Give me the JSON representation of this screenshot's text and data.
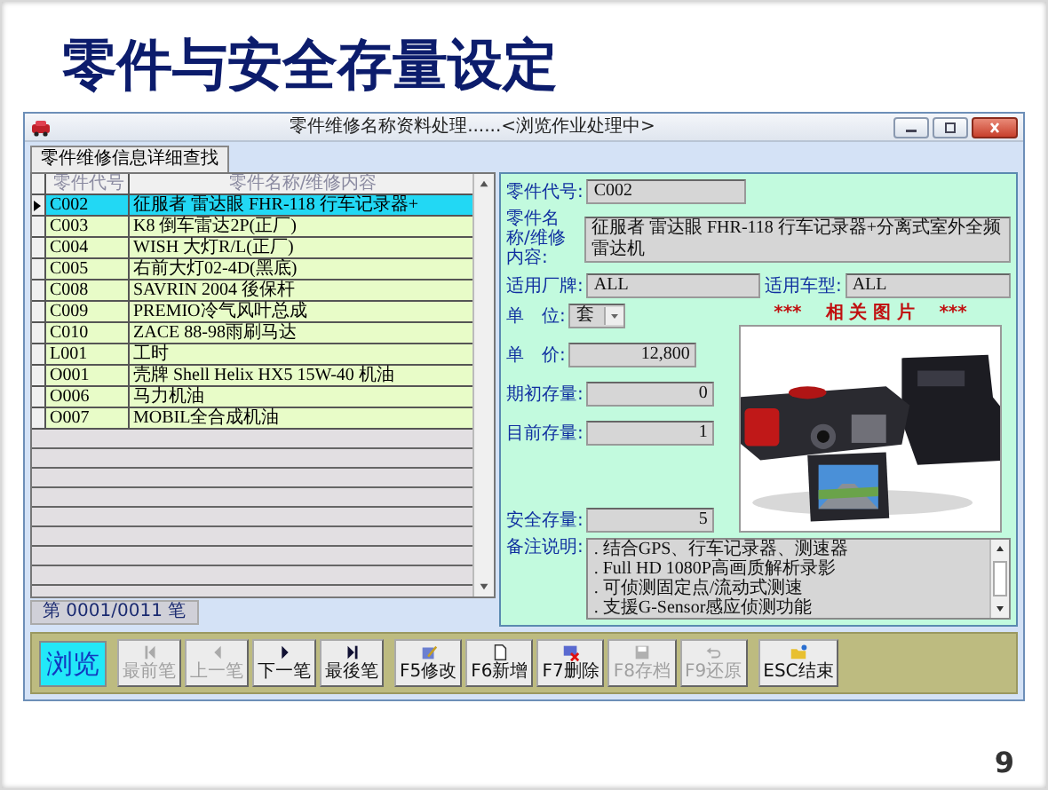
{
  "slide_title": "零件与安全存量设定",
  "window": {
    "title": "零件维修名称资料处理......<浏览作业处理中>"
  },
  "search_button": "零件维修信息详细查找",
  "table": {
    "columns": [
      "零件代号",
      "零件名称/维修内容"
    ],
    "rows": [
      {
        "code": "C002",
        "name": "征服者 雷达眼 FHR-118 行车记录器+",
        "selected": true
      },
      {
        "code": "C003",
        "name": "K8 倒车雷达2P(正厂)",
        "selected": false
      },
      {
        "code": "C004",
        "name": "WISH 大灯R/L(正厂)",
        "selected": false
      },
      {
        "code": "C005",
        "name": "右前大灯02-4D(黑底)",
        "selected": false
      },
      {
        "code": "C008",
        "name": "SAVRIN 2004 後保杆",
        "selected": false
      },
      {
        "code": "C009",
        "name": "PREMIO冷气风叶总成",
        "selected": false
      },
      {
        "code": "C010",
        "name": "ZACE 88-98雨刷马达",
        "selected": false
      },
      {
        "code": "L001",
        "name": "工时",
        "selected": false
      },
      {
        "code": "O001",
        "name": "壳牌 Shell Helix HX5 15W-40 机油",
        "selected": false
      },
      {
        "code": "O006",
        "name": "马力机油",
        "selected": false
      },
      {
        "code": "O007",
        "name": "MOBIL全合成机油",
        "selected": false
      }
    ]
  },
  "record_status": "第 0001/0011 笔",
  "form": {
    "code": {
      "label": "零件代号:",
      "value": "C002"
    },
    "name": {
      "label": "零件名称/维修内容:",
      "value": "征服者 雷达眼 FHR-118 行车记录器+分离式室外全频雷达机"
    },
    "brand": {
      "label": "适用厂牌:",
      "value": "ALL"
    },
    "model": {
      "label": "适用车型:",
      "value": "ALL"
    },
    "unit": {
      "label": "单　位:",
      "value": "套"
    },
    "price": {
      "label": "单　价:",
      "value": "12,800"
    },
    "opening_stock": {
      "label": "期初存量:",
      "value": "0"
    },
    "current_stock": {
      "label": "目前存量:",
      "value": "1"
    },
    "safety_stock": {
      "label": "安全存量:",
      "value": "5"
    },
    "picture_heading": "***　 相 关 图 片　 ***",
    "notes": {
      "label": "备注说明:",
      "lines": [
        ". 结合GPS、行车记录器、测速器",
        ". Full HD 1080P高画质解析录影",
        ". 可侦测固定点/流动式测速",
        ". 支援G-Sensor感应侦测功能"
      ]
    }
  },
  "button_bar": {
    "mode": "浏览",
    "groups": [
      [
        {
          "kind": "first",
          "label": "最前笔",
          "disabled": true
        },
        {
          "kind": "prev",
          "label": "上一笔",
          "disabled": true
        },
        {
          "kind": "next",
          "label": "下一笔",
          "disabled": false
        },
        {
          "kind": "last",
          "label": "最後笔",
          "disabled": false
        }
      ],
      [
        {
          "kind": "edit",
          "label": "F5修改",
          "disabled": false
        },
        {
          "kind": "new",
          "label": "F6新增",
          "disabled": false
        },
        {
          "kind": "delete",
          "label": "F7删除",
          "disabled": false
        },
        {
          "kind": "save",
          "label": "F8存档",
          "disabled": true
        },
        {
          "kind": "undo",
          "label": "F9还原",
          "disabled": true
        }
      ],
      [
        {
          "kind": "exit",
          "label": "ESC结束",
          "disabled": false
        }
      ]
    ]
  },
  "page_number": "9"
}
